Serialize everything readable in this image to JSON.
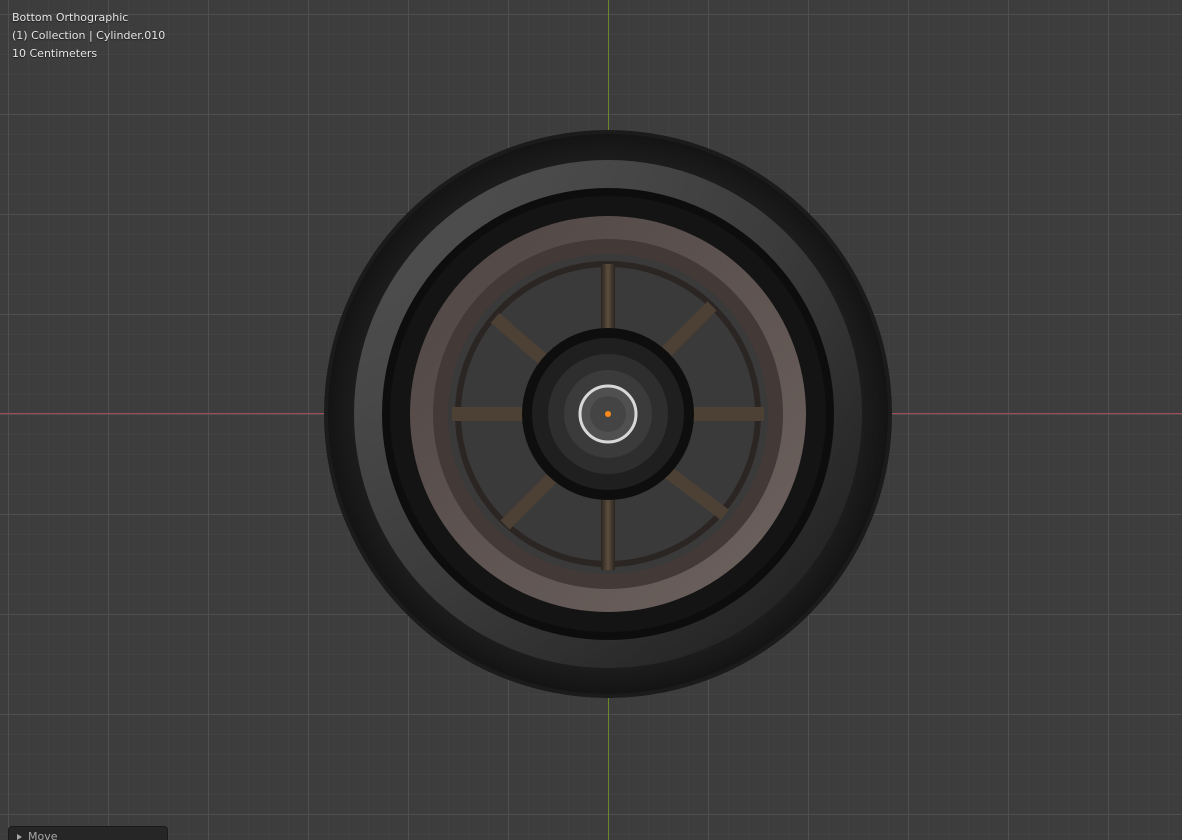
{
  "viewport": {
    "view_name": "Bottom Orthographic",
    "collection_info": "(1) Collection | Cylinder.010",
    "grid_scale": "10 Centimeters"
  },
  "operator_panel": {
    "label": "Move"
  },
  "colors": {
    "background": "#3d3d3d",
    "x_axis": "#a34a55",
    "y_axis": "#6a8a2a",
    "origin_dot": "#ff8c1a",
    "tire": "#1e1e1e",
    "rim": "#5e534f",
    "spoke": "#3a3128"
  },
  "icons": {
    "panel_toggle": "triangle-right-icon"
  }
}
